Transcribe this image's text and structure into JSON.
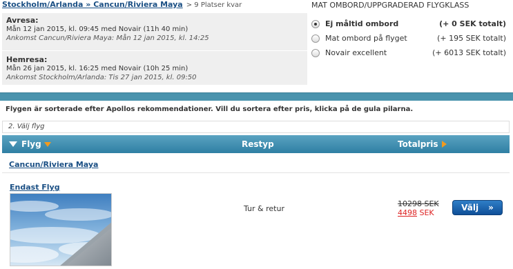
{
  "header": {
    "route_link": "Stockholm/Arlanda » Cancun/Riviera Maya",
    "seats_left": "> 9 Platser kvar",
    "meal_title": "MAT OMBORD/UPPGRADERAD FLYGKLASS"
  },
  "outbound": {
    "title": "Avresa:",
    "departure": "Mån 12 jan 2015, kl. 09:45 med Novair (11h 40 min)",
    "arrival": "Ankomst Cancun/Riviera Maya: Mån 12 jan 2015, kl. 14:25"
  },
  "return": {
    "title": "Hemresa:",
    "departure": "Mån 26 jan 2015, kl. 16:25 med Novair (10h 25 min)",
    "arrival": "Ankomst Stockholm/Arlanda: Tis 27 jan 2015, kl. 09:50"
  },
  "meal_options": [
    {
      "label": "Ej måltid ombord",
      "price": "(+ 0 SEK totalt)",
      "selected": true
    },
    {
      "label": "Mat ombord på flyget",
      "price": "(+ 195 SEK totalt)",
      "selected": false
    },
    {
      "label": "Novair excellent",
      "price": "(+ 6013 SEK totalt)",
      "selected": false
    }
  ],
  "sort_note": "Flygen är sorterade efter Apollos rekommendationer. Vill du sortera efter pris, klicka på de gula pilarna.",
  "step_label": "2. Välj flyg",
  "table": {
    "col_flyg": "Flyg",
    "col_restyp": "Restyp",
    "col_total": "Totalpris"
  },
  "destination": "Cancun/Riviera Maya",
  "product": {
    "name": "Endast Flyg",
    "trip_type": "Tur & retur",
    "old_price": "10298 SEK",
    "new_price_amount": "4498",
    "new_price_currency": "SEK",
    "button_label": "Välj",
    "button_chevron": "»"
  },
  "colors": {
    "link": "#1a4f84",
    "header_bar": "#2f7fa3",
    "sort_arrow": "#f39a1d",
    "sale_price": "#dd2222",
    "button": "#1a63ad"
  }
}
